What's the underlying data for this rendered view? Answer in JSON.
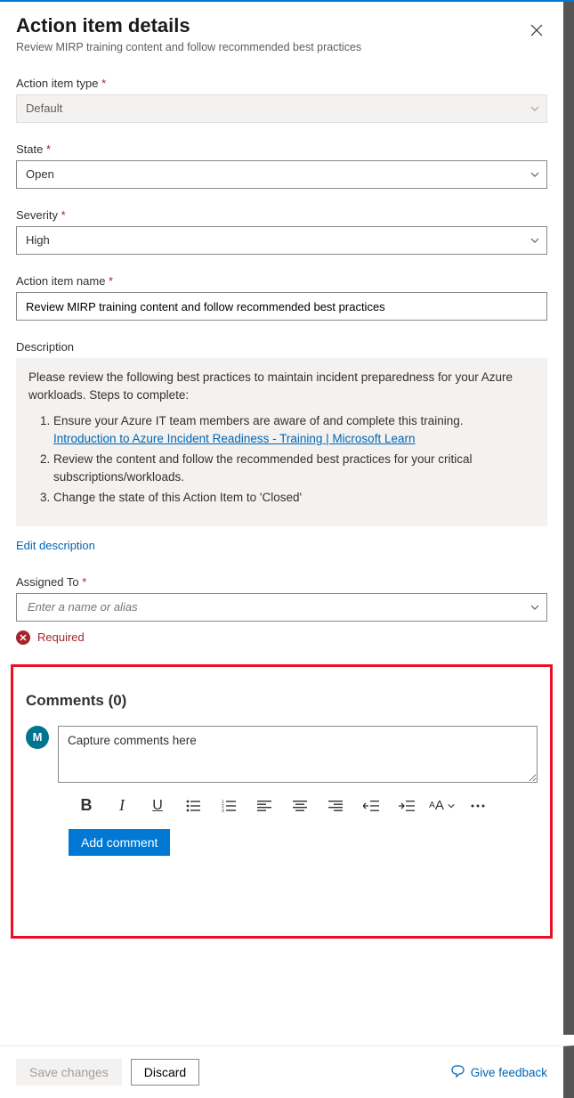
{
  "header": {
    "title": "Action item details",
    "subtitle": "Review MIRP training content and follow recommended best practices"
  },
  "fields": {
    "type": {
      "label": "Action item type",
      "value": "Default"
    },
    "state": {
      "label": "State",
      "value": "Open"
    },
    "severity": {
      "label": "Severity",
      "value": "High"
    },
    "name": {
      "label": "Action item name",
      "value": "Review MIRP training content and follow recommended best practices"
    },
    "description": {
      "label": "Description",
      "intro": "Please review the following best practices to maintain incident preparedness for your Azure workloads. Steps to complete:",
      "step1_a": "Ensure your Azure IT team members are aware of and complete this training.",
      "step1_link": "Introduction to Azure Incident Readiness - Training | Microsoft Learn",
      "step2": "Review the content and follow the recommended best practices for your critical subscriptions/workloads.",
      "step3": "Change the state of this Action Item to 'Closed'",
      "edit": "Edit description"
    },
    "assigned": {
      "label": "Assigned To",
      "placeholder": "Enter a name or alias",
      "error": "Required"
    }
  },
  "comments": {
    "heading": "Comments (0)",
    "avatar_initial": "M",
    "placeholder": "Capture comments here",
    "add_btn": "Add comment"
  },
  "footer": {
    "save": "Save changes",
    "discard": "Discard",
    "feedback": "Give feedback"
  }
}
